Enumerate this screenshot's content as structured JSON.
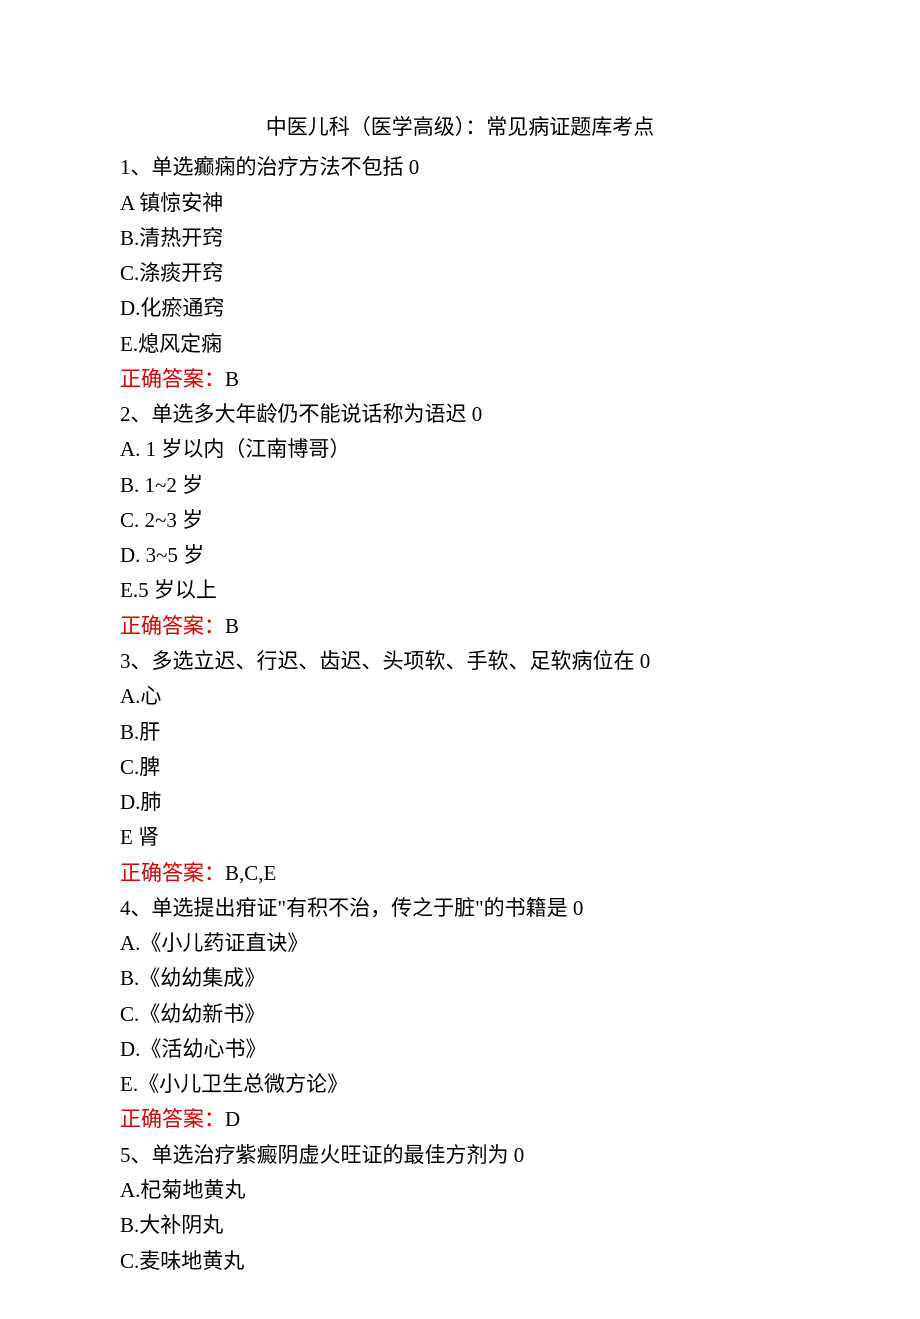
{
  "title": "中医儿科（医学高级）：常见病证题库考点",
  "questions": [
    {
      "number": "1、",
      "type": "单选",
      "stem": "癫痫的治疗方法不包括 0",
      "options": [
        {
          "label": "A",
          "sep": " ",
          "text": "镇惊安神"
        },
        {
          "label": "B",
          "sep": ".",
          "text": "清热开窍"
        },
        {
          "label": "C",
          "sep": ".",
          "text": "涤痰开窍"
        },
        {
          "label": "D",
          "sep": ".",
          "text": "化瘀通窍"
        },
        {
          "label": "E",
          "sep": ".",
          "text": "熄风定痫"
        }
      ],
      "answerLabel": "正确答案：",
      "answerValue": "B"
    },
    {
      "number": "2、",
      "type": "单选",
      "stem": "多大年龄仍不能说话称为语迟 0",
      "options": [
        {
          "label": "A",
          "sep": ". ",
          "text": "1 岁以内（江南博哥）"
        },
        {
          "label": "B",
          "sep": ". ",
          "text": "1~2 岁"
        },
        {
          "label": "C",
          "sep": ". ",
          "text": "2~3 岁"
        },
        {
          "label": "D",
          "sep": ". ",
          "text": "3~5 岁"
        },
        {
          "label": "E",
          "sep": ".",
          "text": "5 岁以上"
        }
      ],
      "answerLabel": "正确答案：",
      "answerValue": "B"
    },
    {
      "number": "3、",
      "type": "多选",
      "stem": "立迟、行迟、齿迟、头项软、手软、足软病位在 0",
      "options": [
        {
          "label": "A",
          "sep": ".",
          "text": "心"
        },
        {
          "label": "B",
          "sep": ".",
          "text": "肝"
        },
        {
          "label": "C",
          "sep": ".",
          "text": "脾"
        },
        {
          "label": "D",
          "sep": ".",
          "text": "肺"
        },
        {
          "label": "E",
          "sep": " ",
          "text": "肾"
        }
      ],
      "answerLabel": "正确答案：",
      "answerValue": "B,C,E"
    },
    {
      "number": "4、",
      "type": "单选",
      "stem": "提出疳证\"有积不治，传之于脏\"的书籍是 0",
      "options": [
        {
          "label": "A",
          "sep": ".",
          "text": "《小儿药证直诀》"
        },
        {
          "label": "B",
          "sep": ".",
          "text": "《幼幼集成》"
        },
        {
          "label": "C",
          "sep": ".",
          "text": "《幼幼新书》"
        },
        {
          "label": "D",
          "sep": ".",
          "text": "《活幼心书》"
        },
        {
          "label": "E",
          "sep": ".",
          "text": "《小儿卫生总微方论》"
        }
      ],
      "answerLabel": "正确答案：",
      "answerValue": "D"
    },
    {
      "number": "5、",
      "type": "单选",
      "stem": "治疗紫癜阴虚火旺证的最佳方剂为 0",
      "options": [
        {
          "label": "A",
          "sep": ".",
          "text": "杞菊地黄丸"
        },
        {
          "label": "B",
          "sep": ".",
          "text": "大补阴丸"
        },
        {
          "label": "C",
          "sep": ".",
          "text": "麦味地黄丸"
        }
      ],
      "answerLabel": null,
      "answerValue": null
    }
  ]
}
